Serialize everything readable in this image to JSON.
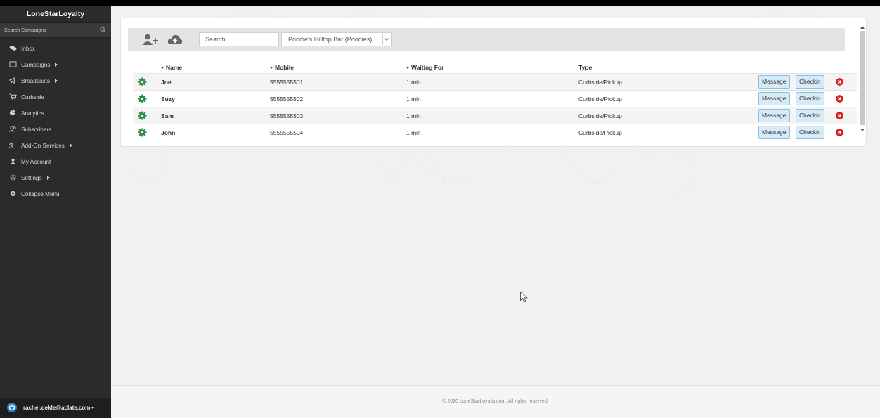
{
  "sidebar": {
    "brand": "LoneStarLoyalty",
    "search_placeholder": "Search Campaigns",
    "items": [
      {
        "label": "Inbox",
        "icon": "chat-icon",
        "has_submenu": false
      },
      {
        "label": "Campaigns",
        "icon": "columns-icon",
        "has_submenu": true
      },
      {
        "label": "Broadcasts",
        "icon": "megaphone-icon",
        "has_submenu": true
      },
      {
        "label": "Curbside",
        "icon": "cart-icon",
        "has_submenu": false
      },
      {
        "label": "Analytics",
        "icon": "pie-chart-icon",
        "has_submenu": false
      },
      {
        "label": "Subscribers",
        "icon": "people-icon",
        "has_submenu": false
      },
      {
        "label": "Add-On Services",
        "icon": "dollar-icon",
        "has_submenu": true
      },
      {
        "label": "My Account",
        "icon": "user-icon",
        "has_submenu": false
      },
      {
        "label": "Settings",
        "icon": "gear-icon",
        "has_submenu": true
      },
      {
        "label": "Collapse Menu",
        "icon": "circle-icon",
        "has_submenu": false
      }
    ],
    "user_email": "rachel.dekle@aclate.com"
  },
  "toolbar": {
    "search_placeholder": "Search...",
    "location_selected": "Poodie's Hilltop Bar (Poodies)"
  },
  "table": {
    "columns": [
      "Name",
      "Mobile",
      "Waiting For",
      "Type"
    ],
    "rows": [
      {
        "name": "Joe",
        "mobile": "5555555501",
        "waiting": "1 min",
        "type": "Curbside/Pickup"
      },
      {
        "name": "Suzy",
        "mobile": "5555555502",
        "waiting": "1 min",
        "type": "Curbside/Pickup"
      },
      {
        "name": "Sam",
        "mobile": "5555555503",
        "waiting": "1 min",
        "type": "Curbside/Pickup"
      },
      {
        "name": "John",
        "mobile": "5555555504",
        "waiting": "1 min",
        "type": "Curbside/Pickup"
      }
    ],
    "message_label": "Message",
    "checkin_label": "Checkin"
  },
  "footer": {
    "copyright": "© 2020 LoneStarLoyalty.com, All rights reserved."
  },
  "colors": {
    "sidebar_bg": "#2b2b2b",
    "gear_green": "#2e8b3a",
    "remove_red": "#d21f1f",
    "button_blue": "#d6ebf8"
  }
}
